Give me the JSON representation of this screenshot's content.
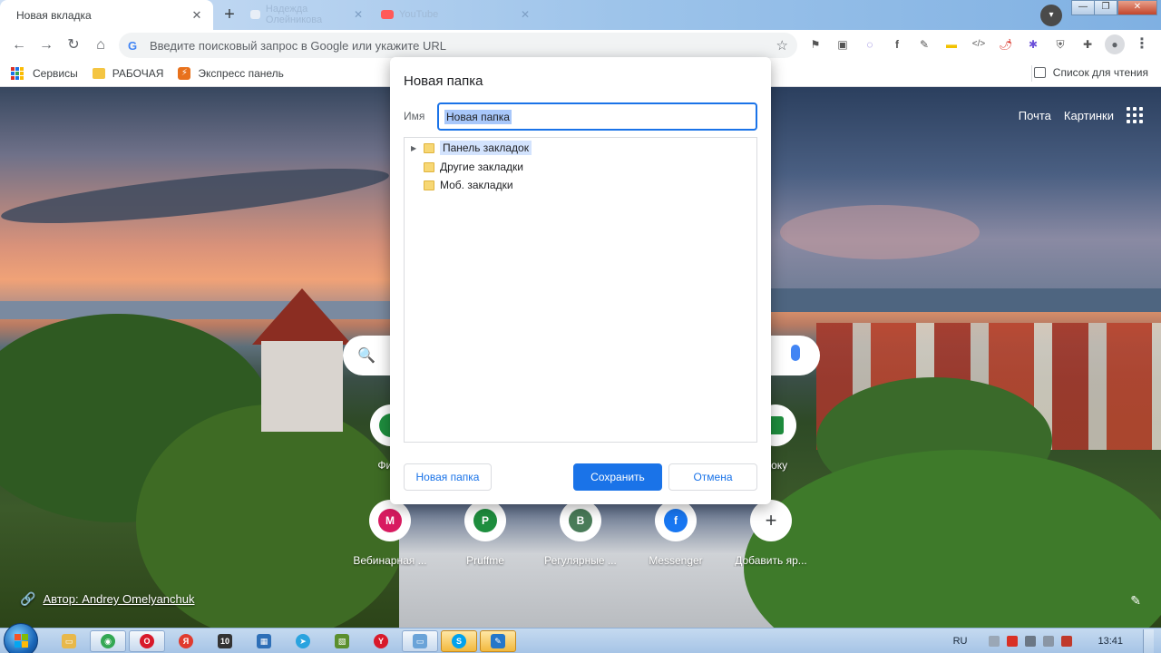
{
  "browser": {
    "active_tab": {
      "title": "Новая вкладка",
      "close": "✕"
    },
    "new_tab": "+",
    "bg_tabs": [
      {
        "title": "Надежда Олейникова",
        "favicon_color": "#e8eef7"
      },
      {
        "title": "YouTube",
        "favicon_color": "#ff5a5a"
      }
    ],
    "window_controls": {
      "minimize": "—",
      "maximize": "❐",
      "close": "✕"
    },
    "omnibox": {
      "placeholder": "Введите поисковый запрос в Google или укажите URL",
      "g": "G"
    },
    "extensions": [
      {
        "name": "ext-1",
        "glyph": "⚑",
        "color": "#444"
      },
      {
        "name": "ext-2",
        "glyph": "▣",
        "color": "#555"
      },
      {
        "name": "ext-3",
        "glyph": "◌",
        "color": "#6b59d3"
      },
      {
        "name": "ext-4",
        "glyph": "f",
        "color": "#3c4043"
      },
      {
        "name": "ext-5",
        "glyph": "✎",
        "color": "#3c4043"
      },
      {
        "name": "ext-6",
        "glyph": "▬",
        "color": "#f2c200"
      },
      {
        "name": "ext-7",
        "glyph": "</>",
        "color": "#5f6368"
      },
      {
        "name": "ext-8",
        "glyph": "🌶",
        "color": "#d93025"
      },
      {
        "name": "ext-9",
        "glyph": "✱",
        "color": "#6b4fd8"
      },
      {
        "name": "ext-10",
        "glyph": "⛨",
        "color": "#5f6368"
      },
      {
        "name": "ext-11",
        "glyph": "✚",
        "color": "#5f6368"
      }
    ]
  },
  "bookmarks": {
    "items": [
      {
        "label": "Сервисы"
      },
      {
        "label": "РАБОЧАЯ"
      },
      {
        "label": "Экспресс панель"
      }
    ],
    "reading_list": "Список для чтения"
  },
  "newtab": {
    "links": {
      "mail": "Почта",
      "images": "Картинки"
    },
    "shortcuts_row1": [
      {
        "label": "Фина",
        "letter": "",
        "color": "#1e8e3e"
      },
      {
        "label": "Доку",
        "letter": "",
        "color": "#1e8e3e"
      }
    ],
    "shortcuts_row2": [
      {
        "label": "Вебинарная ...",
        "letter": "M",
        "color": "#d81b60"
      },
      {
        "label": "Pruffme",
        "letter": "P",
        "color": "#1e8e3e"
      },
      {
        "label": "Регулярные ...",
        "letter": "B",
        "color": "#4a7c59"
      },
      {
        "label": "Messenger",
        "letter": "f",
        "color": "#1877f2"
      },
      {
        "label": "Добавить яр...",
        "letter": "+",
        "color": ""
      }
    ],
    "author": "Автор: Andrey Omelyanchuk"
  },
  "dialog": {
    "title": "Новая папка",
    "name_label": "Имя",
    "name_value": "Новая папка",
    "tree": [
      {
        "label": "Панель закладок",
        "expandable": true,
        "selected": true
      },
      {
        "label": "Другие закладки",
        "expandable": false,
        "selected": false
      },
      {
        "label": "Моб. закладки",
        "expandable": false,
        "selected": false
      }
    ],
    "buttons": {
      "new_folder": "Новая папка",
      "save": "Сохранить",
      "cancel": "Отмена"
    }
  },
  "taskbar": {
    "language": "RU",
    "time": "13:41",
    "apps": [
      {
        "name": "explorer",
        "glyph": "▭",
        "color": "#e8b84a"
      },
      {
        "name": "chrome",
        "glyph": "◉",
        "color": "#34a853"
      },
      {
        "name": "opera",
        "glyph": "O",
        "color": "#d8192a"
      },
      {
        "name": "yandex-app",
        "glyph": "Я",
        "color": "#e03a2e"
      },
      {
        "name": "app-10",
        "glyph": "10",
        "color": "#333333"
      },
      {
        "name": "app-monitor",
        "glyph": "▦",
        "color": "#2e6fb7"
      },
      {
        "name": "telegram",
        "glyph": "➤",
        "color": "#2aa3df"
      },
      {
        "name": "app-green",
        "glyph": "▧",
        "color": "#5b8f2e"
      },
      {
        "name": "yandex-browser",
        "glyph": "Y",
        "color": "#d8192a"
      },
      {
        "name": "app-window",
        "glyph": "▭",
        "color": "#6aa3d8"
      },
      {
        "name": "skype",
        "glyph": "S",
        "color": "#00a2ed"
      },
      {
        "name": "app-edit",
        "glyph": "✎",
        "color": "#2577c9"
      }
    ]
  }
}
